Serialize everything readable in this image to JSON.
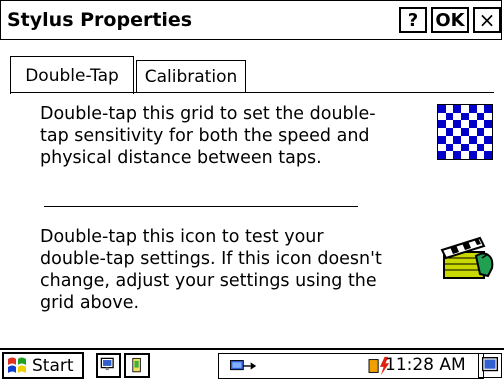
{
  "window": {
    "title": "Stylus Properties",
    "help_label": "?",
    "ok_label": "OK",
    "close_label": "×"
  },
  "tabs": [
    {
      "label": "Double-Tap",
      "active": true
    },
    {
      "label": "Calibration",
      "active": false
    }
  ],
  "content": {
    "paragraph1": "Double-tap this grid to set the double-\ntap sensitivity for both the speed and\nphysical distance between taps.",
    "paragraph2": "Double-tap this icon to test your\ndouble-tap settings. If this icon doesn't\nchange, adjust your settings using the\ngrid above.",
    "grid_icon": "checkerboard-grid-icon",
    "test_icon": "clapperboard-icon"
  },
  "taskbar": {
    "start_label": "Start",
    "clock": "11:28 AM",
    "colors": {
      "accent_blue": "#0000c8",
      "flag_red": "#e03020",
      "flag_green": "#20a020",
      "flag_yellow": "#f0d000"
    }
  }
}
